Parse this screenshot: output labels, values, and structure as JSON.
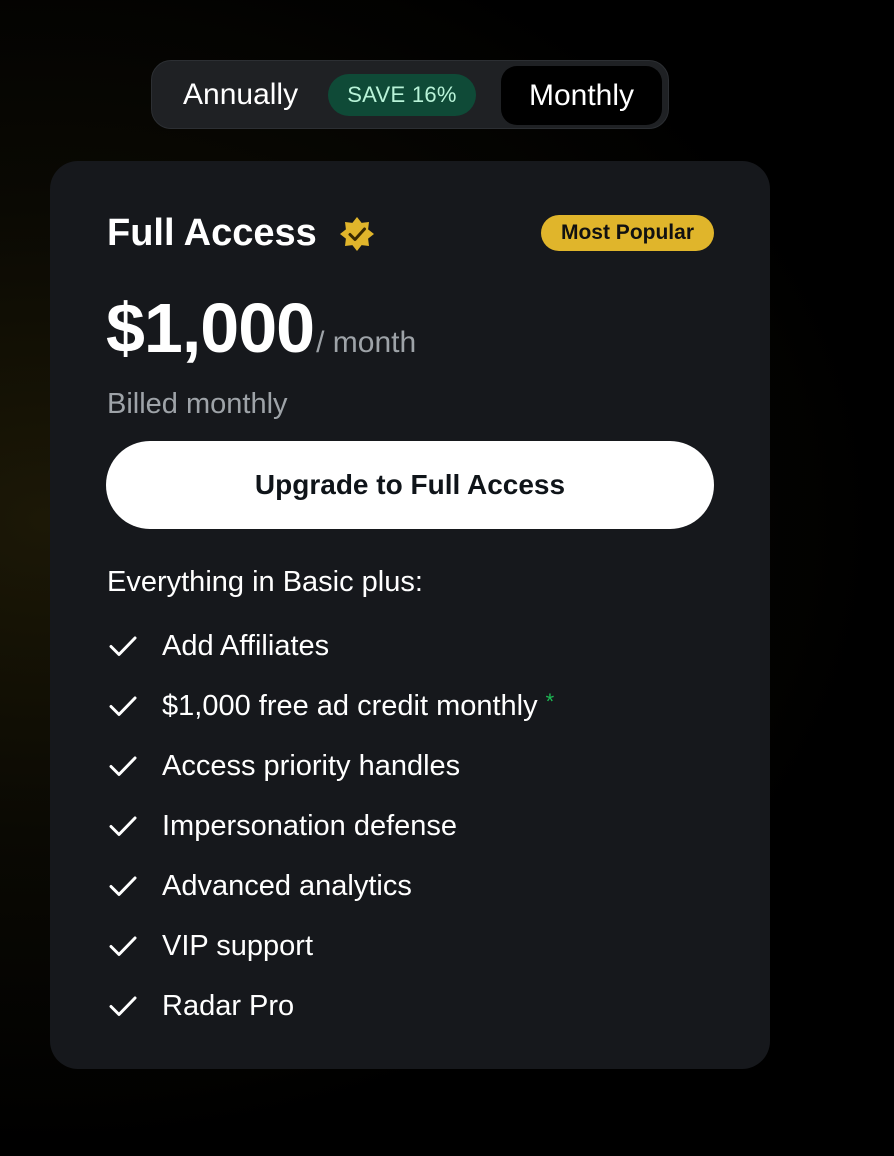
{
  "billing_toggle": {
    "annual_label": "Annually",
    "save_badge": "SAVE 16%",
    "monthly_label": "Monthly",
    "selected": "Monthly"
  },
  "plan": {
    "title": "Full Access",
    "title_icon": "verified-badge-icon",
    "badge": "Most Popular",
    "price": "$1,000",
    "period": "/ month",
    "billing_note": "Billed monthly",
    "cta_label": "Upgrade to Full Access",
    "features_heading": "Everything in Basic plus:",
    "features": [
      {
        "label": "Add Affiliates",
        "note": ""
      },
      {
        "label": "$1,000 free ad credit monthly",
        "note": "*"
      },
      {
        "label": "Access priority handles",
        "note": ""
      },
      {
        "label": "Impersonation defense",
        "note": ""
      },
      {
        "label": "Advanced analytics",
        "note": ""
      },
      {
        "label": "VIP support",
        "note": ""
      },
      {
        "label": "Radar Pro",
        "note": ""
      }
    ]
  },
  "colors": {
    "popular_badge": "#e0b52b",
    "save_badge_bg": "#0f4a37",
    "save_badge_text": "#b8f3d8",
    "asterisk": "#1db954",
    "card_bg": "#16181c"
  }
}
